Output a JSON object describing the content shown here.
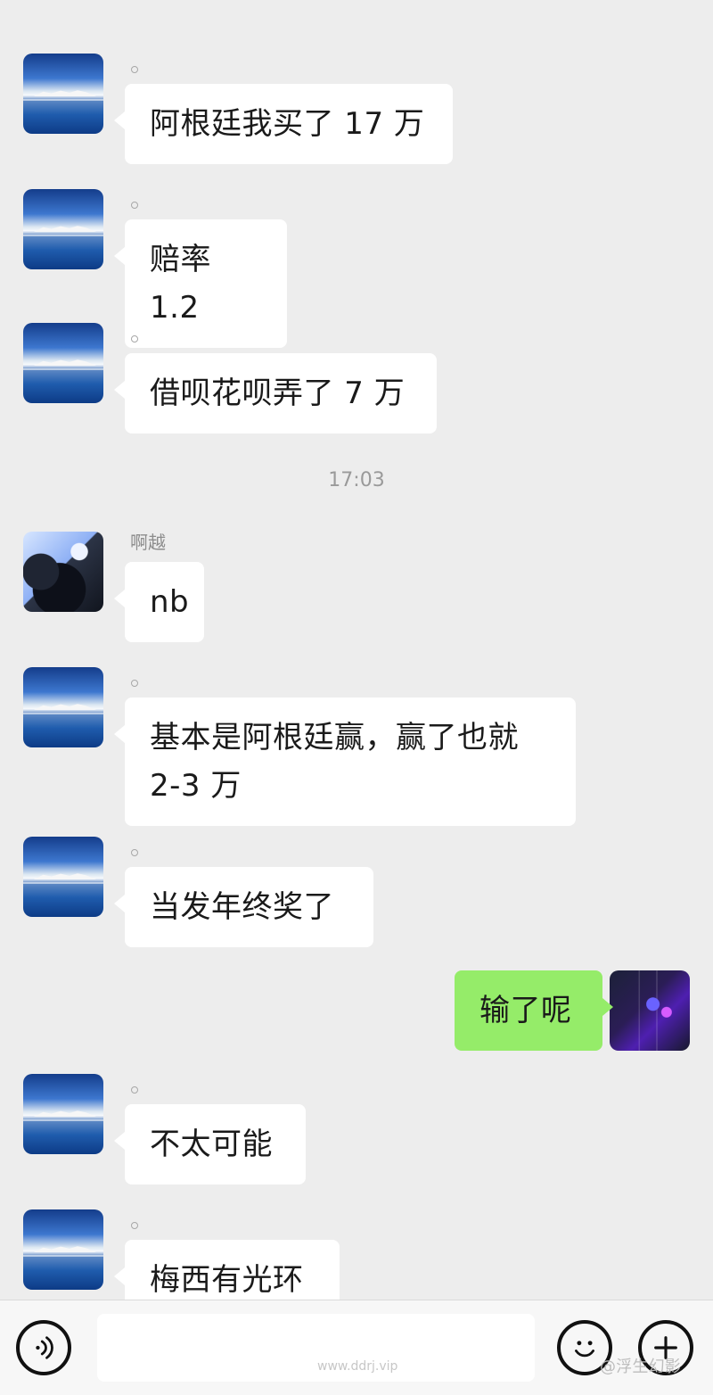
{
  "chat": {
    "timestamp": "17:03",
    "messages": [
      {
        "sender_name": "",
        "text": "阿根廷我买了 17 万",
        "avatar_icon": "landscape-avatar"
      },
      {
        "sender_name": "",
        "text": "赔率 1.2",
        "avatar_icon": "landscape-avatar"
      },
      {
        "sender_name": "",
        "text": "借呗花呗弄了 7 万",
        "avatar_icon": "landscape-avatar"
      },
      {
        "sender_name": "啊越",
        "text": "nb",
        "avatar_icon": "anime-avatar"
      },
      {
        "sender_name": "",
        "text": "基本是阿根廷赢，赢了也就 2-3 万",
        "avatar_icon": "landscape-avatar"
      },
      {
        "sender_name": "",
        "text": "当发年终奖了",
        "avatar_icon": "landscape-avatar"
      },
      {
        "sender_name": "",
        "text": "输了呢",
        "avatar_icon": "neon-avatar",
        "side": "self"
      },
      {
        "sender_name": "",
        "text": "不太可能",
        "avatar_icon": "landscape-avatar"
      },
      {
        "sender_name": "",
        "text": "梅西有光环",
        "avatar_icon": "landscape-avatar"
      }
    ]
  },
  "bottom_bar": {
    "watermark_site": "www.ddrj.vip",
    "watermark_user": "@浮生幻影",
    "icons": {
      "voice": "voice-icon",
      "emoji": "emoji-icon",
      "plus": "plus-icon"
    }
  },
  "colors": {
    "background": "#ededed",
    "bubble_other": "#ffffff",
    "bubble_self": "#95ec69",
    "meta_text": "#9a9a9a"
  }
}
